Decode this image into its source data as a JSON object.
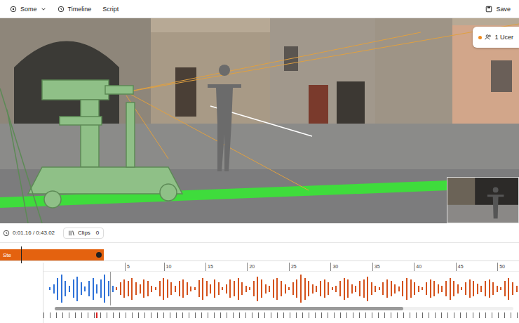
{
  "toolbar": {
    "items": [
      {
        "label": "Some",
        "icon": "scene",
        "dropdown": true
      },
      {
        "label": "Timeline",
        "icon": "clock",
        "dropdown": false
      },
      {
        "label": "Script",
        "icon": "none",
        "dropdown": false
      }
    ],
    "save": "Save"
  },
  "viewport": {
    "users_badge": "1 Ucer"
  },
  "transport": {
    "time": "0:01.16 / 0:43.02",
    "clips_label": "Clips",
    "clips_count": "0"
  },
  "track": {
    "label": "Ste",
    "level": 0.2,
    "playhead": 0.04
  },
  "ruler": [
    "5",
    "10",
    "15",
    "20",
    "25",
    "30",
    "35",
    "40",
    "45",
    "50"
  ],
  "waveform": {
    "progress": 0.14,
    "samples": [
      0.1,
      0.3,
      0.7,
      0.9,
      0.5,
      0.2,
      0.6,
      0.8,
      0.4,
      0.15,
      0.5,
      0.7,
      0.3,
      0.6,
      0.9,
      0.5,
      0.2,
      0.1,
      0.4,
      0.6,
      0.5,
      0.7,
      0.4,
      0.3,
      0.6,
      0.5,
      0.2,
      0.1,
      0.5,
      0.7,
      0.6,
      0.4,
      0.2,
      0.5,
      0.6,
      0.4,
      0.15,
      0.1,
      0.55,
      0.7,
      0.5,
      0.3,
      0.6,
      0.4,
      0.1,
      0.3,
      0.6,
      0.5,
      0.7,
      0.4,
      0.2,
      0.1,
      0.5,
      0.8,
      0.6,
      0.3,
      0.2,
      0.6,
      0.7,
      0.5,
      0.3,
      0.1,
      0.4,
      0.6,
      0.9,
      0.7,
      0.5,
      0.3,
      0.2,
      0.5,
      0.6,
      0.4,
      0.1,
      0.2,
      0.5,
      0.7,
      0.6,
      0.3,
      0.2,
      0.5,
      0.6,
      0.8,
      0.4,
      0.2,
      0.1,
      0.4,
      0.6,
      0.5,
      0.3,
      0.15,
      0.5,
      0.7,
      0.6,
      0.4,
      0.2,
      0.1,
      0.4,
      0.6,
      0.5,
      0.3,
      0.2,
      0.5,
      0.7,
      0.5,
      0.3,
      0.1,
      0.4,
      0.6,
      0.5,
      0.35,
      0.2,
      0.5,
      0.6,
      0.4,
      0.2,
      0.1,
      0.5,
      0.7,
      0.4,
      0.2
    ]
  },
  "scrollbar": {
    "level": 0.76
  },
  "ticks": {
    "marker": 0.11
  }
}
